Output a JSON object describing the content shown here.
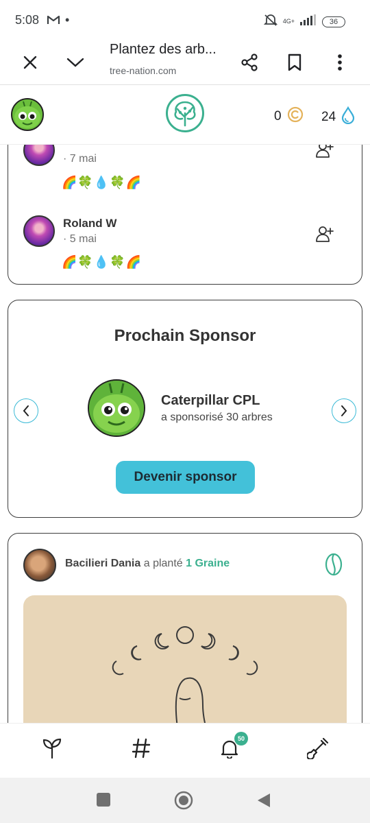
{
  "status_bar": {
    "time": "5:08",
    "dot": "•",
    "network": "4G+",
    "battery": "36"
  },
  "browser": {
    "title": "Plantez des arb...",
    "url": "tree-nation.com"
  },
  "header": {
    "coins": "0",
    "drops": "24"
  },
  "comments": [
    {
      "name": "",
      "date": "· 7 mai",
      "emojis": "🌈🍀💧🍀🌈"
    },
    {
      "name": "Roland W",
      "date": "· 5 mai",
      "emojis": "🌈🍀💧🍀🌈"
    }
  ],
  "sponsor": {
    "title": "Prochain Sponsor",
    "name": "Caterpillar CPL",
    "subtitle": "a sponsorisé 30 arbres",
    "button": "Devenir sponsor"
  },
  "post": {
    "user": "Bacilieri Dania",
    "verb": "a planté",
    "item": "1 Graine"
  },
  "bottom_nav": {
    "notification_count": "50"
  },
  "colors": {
    "brand_green": "#3bb08f",
    "accent_cyan": "#43c1d9",
    "coin_gold": "#e4b25a",
    "drop_blue": "#3aaed8"
  }
}
